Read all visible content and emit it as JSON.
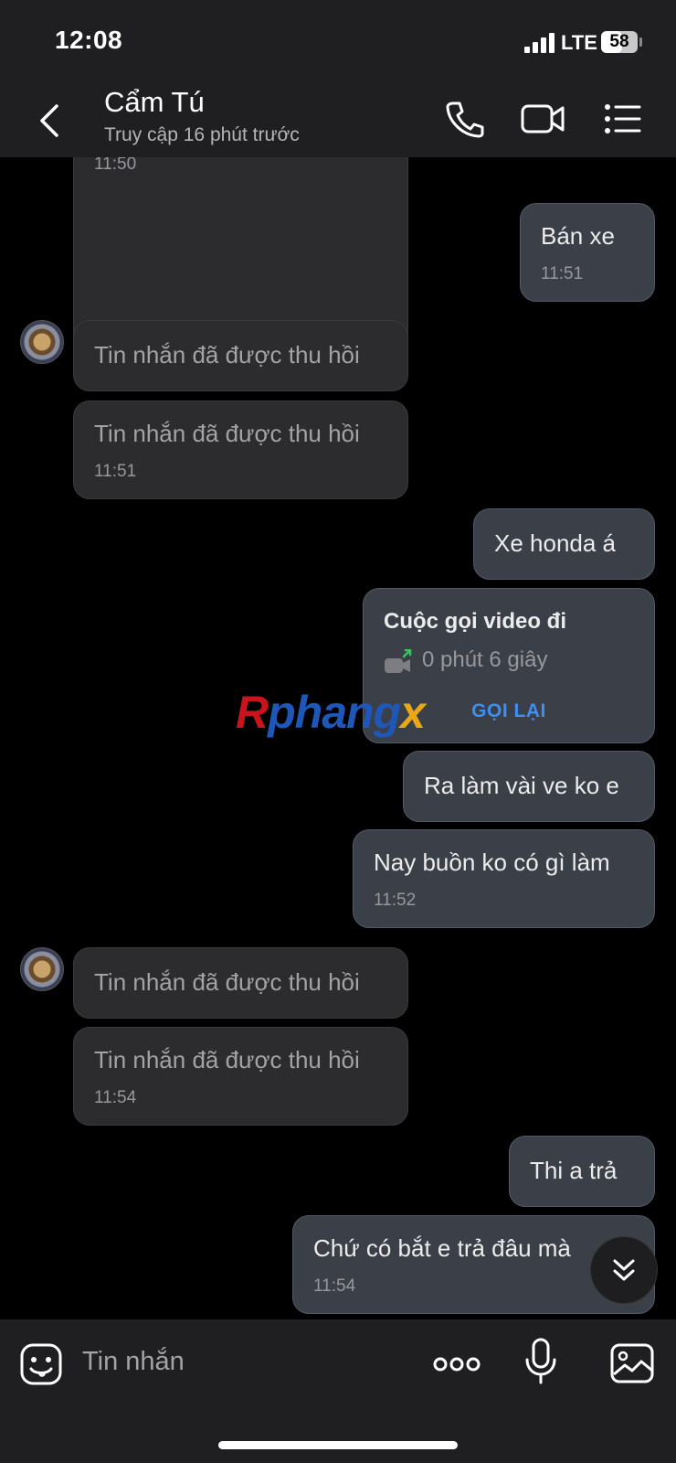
{
  "status_bar": {
    "time": "12:08",
    "network": "LTE",
    "battery": "58",
    "battery_level": 0.58
  },
  "header": {
    "contact_name": "Cẩm Tú",
    "last_seen": "Truy cập 16 phút trước"
  },
  "messages": [
    {
      "direction": "received",
      "text": "",
      "time": "11:50"
    },
    {
      "direction": "sent",
      "text": "Bán xe",
      "time": "11:51"
    },
    {
      "direction": "received",
      "text": "Tin nhắn đã được thu hồi",
      "time": ""
    },
    {
      "direction": "received",
      "text": "Tin nhắn đã được thu hồi",
      "time": "11:51"
    },
    {
      "direction": "sent",
      "text": "Xe honda á",
      "time": ""
    },
    {
      "direction": "sent",
      "type": "call",
      "title": "Cuộc gọi video đi",
      "duration": "0 phút 6 giây",
      "action": "GỌI LẠI"
    },
    {
      "direction": "sent",
      "text": "Ra làm vài ve ko e",
      "time": ""
    },
    {
      "direction": "sent",
      "text": "Nay buồn ko có gì làm",
      "time": "11:52"
    },
    {
      "direction": "received",
      "text": "Tin nhắn đã được thu hồi",
      "time": ""
    },
    {
      "direction": "received",
      "text": "Tin nhắn đã được thu hồi",
      "time": "11:54"
    },
    {
      "direction": "sent",
      "text": "Thi a trả",
      "time": ""
    },
    {
      "direction": "sent",
      "text": "Chứ có bắt e trả đâu mà",
      "time": "11:54"
    }
  ],
  "watermark": {
    "part1": "R",
    "part2": "phang",
    "part3": "x"
  },
  "composer": {
    "placeholder": "Tin nhắn"
  },
  "icons": {
    "back": "chevron-left-icon",
    "call": "phone-icon",
    "video": "video-camera-icon",
    "menu": "list-menu-icon",
    "emoji": "emoji-sticker-icon",
    "more": "more-dots-icon",
    "mic": "microphone-icon",
    "gallery": "image-gallery-icon",
    "scroll": "double-chevron-down-icon"
  },
  "colors": {
    "background": "#000000",
    "bar": "#1f1f21",
    "received_bubble": "#2c2c2e",
    "sent_bubble": "#3b3f48",
    "link": "#3d8ff0"
  }
}
